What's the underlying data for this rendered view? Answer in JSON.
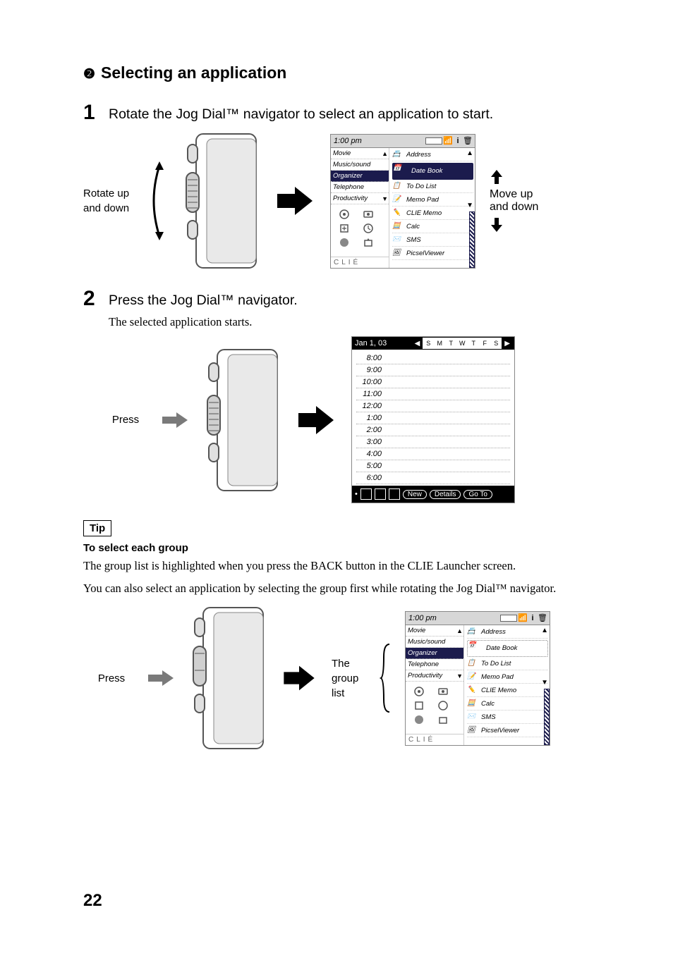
{
  "heading": {
    "num": "2",
    "text": "Selecting an application"
  },
  "step1": {
    "num": "1",
    "text": "Rotate the Jog Dial™ navigator to select an application to start."
  },
  "step2": {
    "num": "2",
    "text": "Press the Jog Dial™ navigator.",
    "sub": "The selected application starts."
  },
  "labels": {
    "rotate": "Rotate up and down",
    "move": "Move up and down",
    "press": "Press",
    "group": "The group list"
  },
  "tip": {
    "label": "Tip",
    "title": "To select each group",
    "body1": "The group list is highlighted when you press the BACK button in the CLIE Launcher screen.",
    "body2": "You can also select an application by selecting the group first while rotating the Jog Dial™ navigator."
  },
  "launcher": {
    "time": "1:00 pm",
    "groups": [
      "Movie",
      "Music/sound",
      "Organizer",
      "Telephone",
      "Productivity"
    ],
    "hl_group_a": 2,
    "hl_group_b": 2,
    "apps": [
      "Address",
      "Date Book",
      "To Do List",
      "Memo Pad",
      "CLIE Memo",
      "Calc",
      "SMS",
      "PicselViewer"
    ],
    "hl_app": 1,
    "logo": "CLIÉ"
  },
  "datebook": {
    "date": "Jan 1, 03",
    "dow": [
      "S",
      "M",
      "T",
      "W",
      "T",
      "F",
      "S"
    ],
    "hours": [
      "8:00",
      "9:00",
      "10:00",
      "11:00",
      "12:00",
      "1:00",
      "2:00",
      "3:00",
      "4:00",
      "5:00",
      "6:00"
    ],
    "buttons": [
      "New",
      "Details",
      "Go To"
    ]
  },
  "page_number": "22"
}
